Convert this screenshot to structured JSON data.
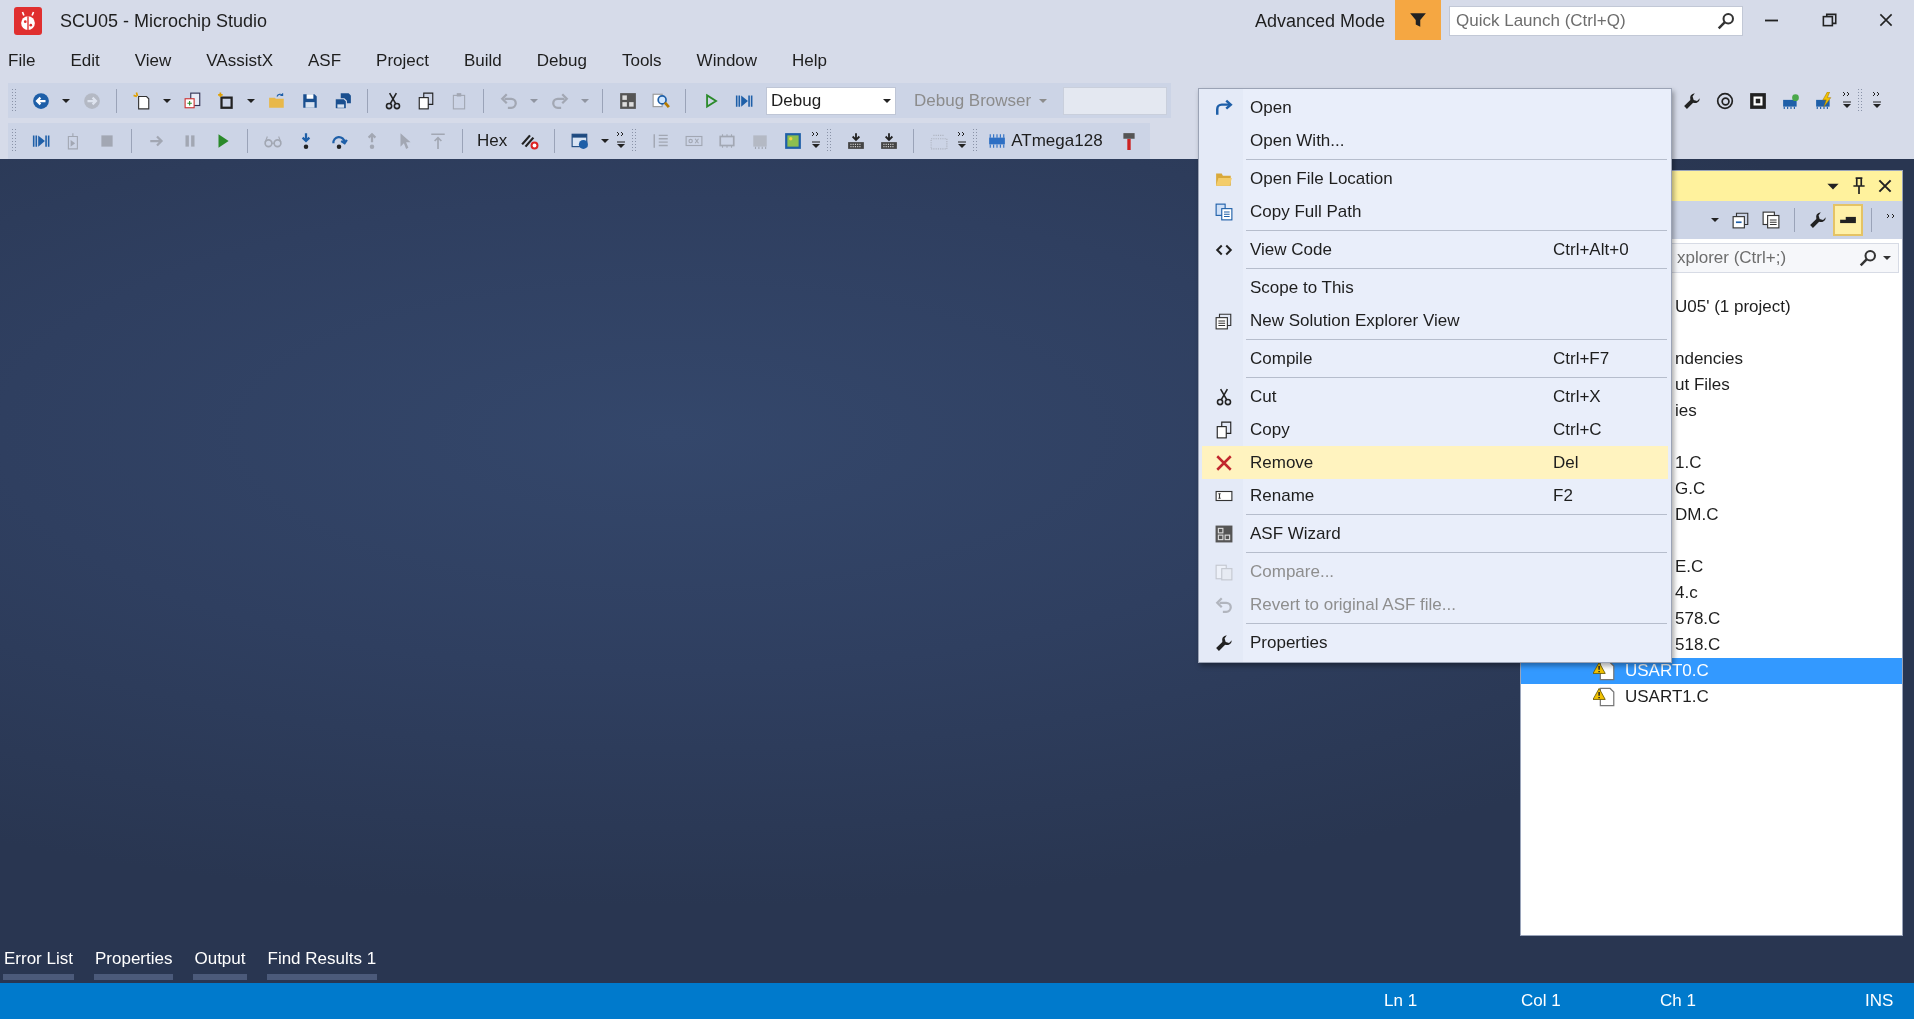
{
  "window": {
    "title": "SCU05 - Microchip Studio",
    "mode_label": "Advanced Mode",
    "quick_launch": {
      "placeholder": "Quick Launch (Ctrl+Q)"
    }
  },
  "menu_bar": [
    "File",
    "Edit",
    "View",
    "VAssistX",
    "ASF",
    "Project",
    "Build",
    "Debug",
    "Tools",
    "Window",
    "Help"
  ],
  "toolbar_1": {
    "left": [
      {
        "kind": "grip"
      },
      {
        "kind": "button",
        "disabled": false
      },
      {
        "kind": "dropdown",
        "disabled": false
      },
      {
        "kind": "button",
        "disabled": true
      },
      {
        "kind": "separator"
      },
      {
        "kind": "button",
        "disabled": false
      },
      {
        "kind": "dropdown",
        "disabled": false
      },
      {
        "kind": "button",
        "disabled": false
      },
      {
        "kind": "button",
        "disabled": false
      },
      {
        "kind": "dropdown",
        "disabled": false
      },
      {
        "kind": "button",
        "disabled": false
      },
      {
        "kind": "button",
        "disabled": false
      },
      {
        "kind": "button",
        "disabled": false
      },
      {
        "kind": "separator"
      },
      {
        "kind": "button",
        "disabled": false
      },
      {
        "kind": "button",
        "disabled": false
      },
      {
        "kind": "button",
        "disabled": true
      },
      {
        "kind": "separator"
      },
      {
        "kind": "button",
        "disabled": true
      },
      {
        "kind": "dropdown",
        "disabled": true
      },
      {
        "kind": "button",
        "disabled": true
      },
      {
        "kind": "dropdown",
        "disabled": true
      },
      {
        "kind": "separator"
      },
      {
        "kind": "button",
        "disabled": false
      },
      {
        "kind": "button",
        "disabled": false
      },
      {
        "kind": "separator"
      },
      {
        "kind": "button",
        "disabled": false
      },
      {
        "kind": "button",
        "disabled": false
      },
      {
        "kind": "combo",
        "value": "Debug"
      },
      {
        "kind": "menu_button",
        "label": "Debug Browser",
        "disabled": true
      },
      {
        "kind": "field"
      }
    ],
    "right": [
      {
        "kind": "button",
        "disabled": false
      },
      {
        "kind": "button",
        "disabled": false
      },
      {
        "kind": "button",
        "disabled": false
      },
      {
        "kind": "button",
        "disabled": false
      },
      {
        "kind": "button",
        "disabled": false
      },
      {
        "kind": "overflow"
      },
      {
        "kind": "grip"
      },
      {
        "kind": "overflow"
      }
    ]
  },
  "toolbar_2": {
    "items": [
      {
        "kind": "grip"
      },
      {
        "kind": "button",
        "disabled": false
      },
      {
        "kind": "button",
        "disabled": true
      },
      {
        "kind": "button",
        "disabled": true
      },
      {
        "kind": "separator"
      },
      {
        "kind": "button",
        "disabled": true
      },
      {
        "kind": "button",
        "disabled": true
      },
      {
        "kind": "button",
        "disabled": false
      },
      {
        "kind": "separator"
      },
      {
        "kind": "button",
        "disabled": true
      },
      {
        "kind": "button",
        "disabled": false
      },
      {
        "kind": "button",
        "disabled": false
      },
      {
        "kind": "button",
        "disabled": true
      },
      {
        "kind": "button",
        "disabled": true
      },
      {
        "kind": "button",
        "disabled": true
      },
      {
        "kind": "separator"
      },
      {
        "kind": "label",
        "text": "Hex"
      },
      {
        "kind": "button",
        "disabled": false
      },
      {
        "kind": "separator"
      },
      {
        "kind": "button",
        "disabled": false
      },
      {
        "kind": "dropdown",
        "disabled": false
      },
      {
        "kind": "overflow"
      },
      {
        "kind": "grip"
      },
      {
        "kind": "button",
        "disabled": true
      },
      {
        "kind": "button",
        "disabled": true
      },
      {
        "kind": "button",
        "disabled": true
      },
      {
        "kind": "button",
        "disabled": true
      },
      {
        "kind": "button",
        "disabled": false
      },
      {
        "kind": "overflow"
      },
      {
        "kind": "grip"
      },
      {
        "kind": "button",
        "disabled": false
      },
      {
        "kind": "button",
        "disabled": false
      },
      {
        "kind": "separator"
      },
      {
        "kind": "button",
        "disabled": true
      },
      {
        "kind": "overflow"
      },
      {
        "kind": "grip"
      },
      {
        "kind": "device",
        "label": "ATmega128"
      },
      {
        "kind": "button",
        "disabled": false
      }
    ]
  },
  "context_menu": {
    "items": [
      {
        "kind": "item",
        "label": "Open",
        "selected": false,
        "disabled": false
      },
      {
        "kind": "item",
        "label": "Open With...",
        "selected": false,
        "disabled": false
      },
      {
        "kind": "separator"
      },
      {
        "kind": "item",
        "label": "Open File Location",
        "selected": false,
        "disabled": false
      },
      {
        "kind": "item",
        "label": "Copy Full Path",
        "selected": false,
        "disabled": false
      },
      {
        "kind": "separator"
      },
      {
        "kind": "item",
        "label": "View Code",
        "shortcut": "Ctrl+Alt+0",
        "selected": false,
        "disabled": false
      },
      {
        "kind": "separator"
      },
      {
        "kind": "item",
        "label": "Scope to This",
        "selected": false,
        "disabled": false
      },
      {
        "kind": "item",
        "label": "New Solution Explorer View",
        "selected": false,
        "disabled": false
      },
      {
        "kind": "separator"
      },
      {
        "kind": "item",
        "label": "Compile",
        "shortcut": "Ctrl+F7",
        "selected": false,
        "disabled": false
      },
      {
        "kind": "separator"
      },
      {
        "kind": "item",
        "label": "Cut",
        "shortcut": "Ctrl+X",
        "selected": false,
        "disabled": false
      },
      {
        "kind": "item",
        "label": "Copy",
        "shortcut": "Ctrl+C",
        "selected": false,
        "disabled": false
      },
      {
        "kind": "item",
        "label": "Remove",
        "shortcut": "Del",
        "selected": true,
        "disabled": false
      },
      {
        "kind": "item",
        "label": "Rename",
        "shortcut": "F2",
        "selected": false,
        "disabled": false
      },
      {
        "kind": "separator"
      },
      {
        "kind": "item",
        "label": "ASF Wizard",
        "selected": false,
        "disabled": false
      },
      {
        "kind": "separator"
      },
      {
        "kind": "item",
        "label": "Compare...",
        "selected": false,
        "disabled": true
      },
      {
        "kind": "item",
        "label": "Revert to original ASF file...",
        "selected": false,
        "disabled": true
      },
      {
        "kind": "separator"
      },
      {
        "kind": "item",
        "label": "Properties",
        "selected": false,
        "disabled": false
      }
    ]
  },
  "solution_explorer": {
    "toolbar": [
      {
        "kind": "dropdown",
        "pressed": false
      },
      {
        "kind": "button",
        "pressed": false
      },
      {
        "kind": "button",
        "pressed": false
      },
      {
        "kind": "separator"
      },
      {
        "kind": "button",
        "pressed": false
      },
      {
        "kind": "button",
        "pressed": true
      },
      {
        "kind": "separator"
      },
      {
        "kind": "overflow"
      }
    ],
    "search": {
      "placeholder": "xplorer (Ctrl+;)"
    },
    "rows": [
      {
        "label": "U05' (1 project)",
        "covered": true,
        "selected": false
      },
      {
        "label": "ndencies",
        "covered": true,
        "gap_before": true,
        "selected": false
      },
      {
        "label": "ut Files",
        "covered": true,
        "selected": false
      },
      {
        "label": "ies",
        "covered": true,
        "selected": false
      },
      {
        "label": "1.C",
        "covered": true,
        "gap_before": true,
        "selected": false
      },
      {
        "label": "G.C",
        "covered": true,
        "selected": false
      },
      {
        "label": "DM.C",
        "covered": true,
        "selected": false
      },
      {
        "label": "E.C",
        "covered": true,
        "gap_before": true,
        "selected": false
      },
      {
        "label": "4.c",
        "covered": true,
        "selected": false
      },
      {
        "label": "578.C",
        "covered": true,
        "selected": false
      },
      {
        "label": "518.C",
        "covered": true,
        "selected": false
      },
      {
        "label": "USART0.C",
        "covered": false,
        "selected": true
      },
      {
        "label": "USART1.C",
        "covered": false,
        "selected": false
      }
    ]
  },
  "bottom_tabs": [
    "Error List",
    "Properties",
    "Output",
    "Find Results 1"
  ],
  "status_bar": [
    "Ln 1",
    "Col 1",
    "Ch 1",
    "INS"
  ]
}
